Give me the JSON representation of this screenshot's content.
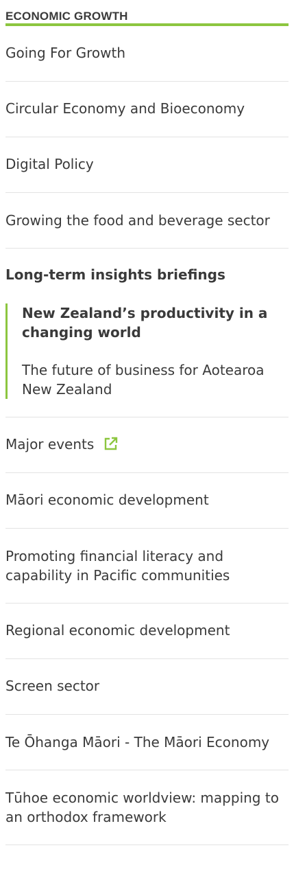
{
  "nav": {
    "title": "ECONOMIC GROWTH",
    "accent_color": "#8cc63f",
    "items": [
      {
        "label": "Going For Growth"
      },
      {
        "label": "Circular Economy and Bioeconomy"
      },
      {
        "label": "Digital Policy"
      },
      {
        "label": "Growing the food and beverage sector"
      }
    ],
    "section": {
      "label": "Long-term insights briefings",
      "children": [
        {
          "label": "New Zealand’s productivity in a changing world",
          "active": true
        },
        {
          "label": "The future of business for Aotearoa New Zealand"
        }
      ]
    },
    "items_after": [
      {
        "label": "Major events",
        "icon": "external-link-icon"
      },
      {
        "label": "Māori economic development"
      },
      {
        "label": "Promoting financial literacy and capability in Pacific communities"
      },
      {
        "label": "Regional economic development"
      },
      {
        "label": "Screen sector"
      },
      {
        "label": "Te Ōhanga Māori - The Māori Economy"
      },
      {
        "label": "Tūhoe economic worldview: mapping to an orthodox framework"
      }
    ]
  }
}
